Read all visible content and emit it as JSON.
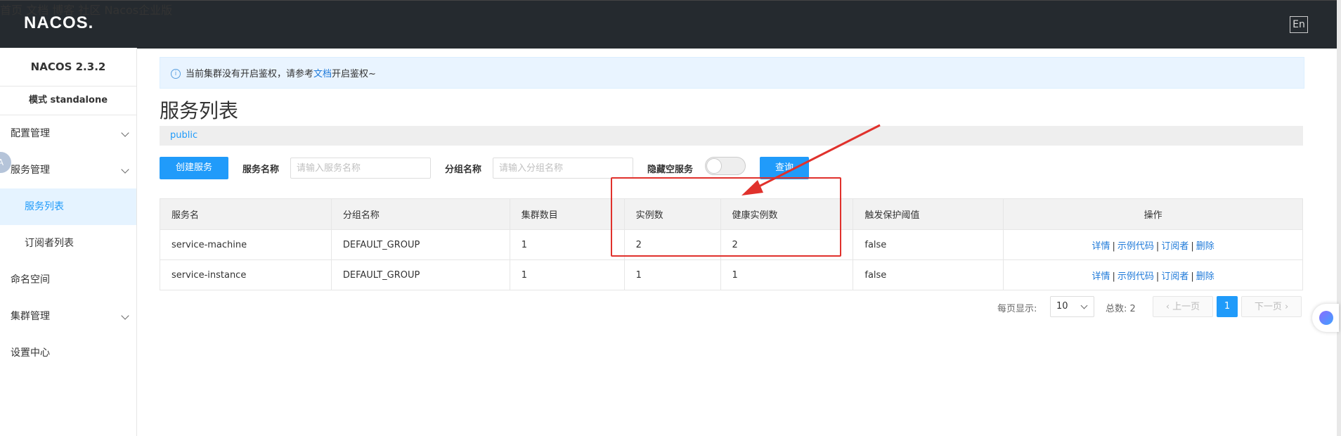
{
  "header": {
    "logo": "NACOS.",
    "nav": [
      "首页",
      "文档",
      "博客",
      "社区",
      "Nacos企业版"
    ],
    "lang": "En"
  },
  "sidebar": {
    "version": "NACOS 2.3.2",
    "mode": "模式 standalone",
    "avatar": "A",
    "items": [
      {
        "label": "配置管理"
      },
      {
        "label": "服务管理"
      },
      {
        "label": "服务列表"
      },
      {
        "label": "订阅者列表"
      },
      {
        "label": "命名空间"
      },
      {
        "label": "集群管理"
      },
      {
        "label": "设置中心"
      }
    ]
  },
  "notice": {
    "prefix": "当前集群没有开启鉴权，请参考",
    "link": "文档",
    "suffix": "开启鉴权~"
  },
  "main": {
    "title": "服务列表",
    "namespace": "public",
    "create_button": "创建服务",
    "service_name_label": "服务名称",
    "service_name_placeholder": "请输入服务名称",
    "group_name_label": "分组名称",
    "group_name_placeholder": "请输入分组名称",
    "hide_empty_label": "隐藏空服务",
    "query_button": "查询"
  },
  "table": {
    "headers": [
      "服务名",
      "分组名称",
      "集群数目",
      "实例数",
      "健康实例数",
      "触发保护阈值",
      "操作"
    ],
    "rows": [
      {
        "name": "service-machine",
        "group": "DEFAULT_GROUP",
        "clusters": "1",
        "instances": "2",
        "healthy": "2",
        "threshold": "false"
      },
      {
        "name": "service-instance",
        "group": "DEFAULT_GROUP",
        "clusters": "1",
        "instances": "1",
        "healthy": "1",
        "threshold": "false"
      }
    ],
    "ops": {
      "detail": "详情",
      "sample": "示例代码",
      "subscriber": "订阅者",
      "delete": "删除",
      "sep": "|"
    }
  },
  "pagination": {
    "page_size_label": "每页显示:",
    "page_size": "10",
    "total_label": "总数: 2",
    "prev": "上一页",
    "current": "1",
    "next": "下一页"
  },
  "colors": {
    "topbar": "#252a2f",
    "primary": "#209bfa",
    "annotation": "#e0312c"
  }
}
